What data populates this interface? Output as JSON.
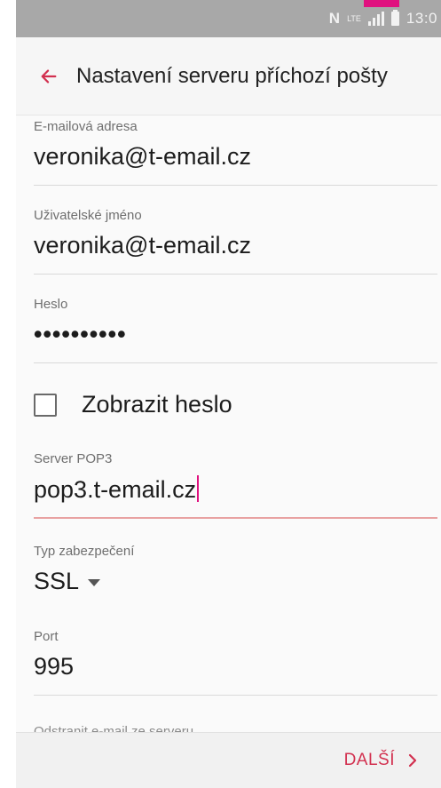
{
  "status_bar": {
    "network_label": "N",
    "lte_label": "LTE",
    "time": "13:0"
  },
  "app_bar": {
    "title": "Nastavení serveru příchozí pošty",
    "back_icon": "arrow-left-icon"
  },
  "form": {
    "email": {
      "label": "E-mailová adresa",
      "value": "veronika@t-email.cz"
    },
    "username": {
      "label": "Uživatelské jméno",
      "value": "veronika@t-email.cz"
    },
    "password": {
      "label": "Heslo",
      "value": "••••••••••"
    },
    "show_password": {
      "label": "Zobrazit heslo",
      "checked": false
    },
    "server": {
      "label": "Server POP3",
      "value": "pop3.t-email.cz"
    },
    "security": {
      "label": "Typ zabezpečení",
      "value": "SSL"
    },
    "port": {
      "label": "Port",
      "value": "995"
    },
    "delete_from_server": {
      "label": "Odstranit e-mail ze serveru"
    }
  },
  "footer": {
    "next_label": "DALŠÍ",
    "next_icon": "chevron-right-icon"
  },
  "colors": {
    "accent": "#d2304f",
    "status_bar": "#a8a8a8",
    "magenta": "#e0117f"
  }
}
